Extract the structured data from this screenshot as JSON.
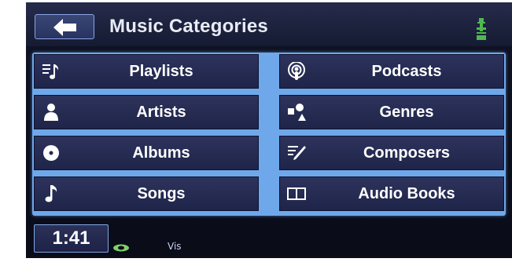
{
  "header": {
    "title": "Music Categories",
    "back_icon": "back-arrow-icon",
    "status_icon": "usb-icon"
  },
  "categories": [
    {
      "label": "Playlists",
      "icon": "playlist-icon"
    },
    {
      "label": "Podcasts",
      "icon": "podcast-icon"
    },
    {
      "label": "Artists",
      "icon": "artist-icon"
    },
    {
      "label": "Genres",
      "icon": "genres-icon"
    },
    {
      "label": "Albums",
      "icon": "album-icon"
    },
    {
      "label": "Composers",
      "icon": "composer-icon"
    },
    {
      "label": "Songs",
      "icon": "song-icon"
    },
    {
      "label": "Audio Books",
      "icon": "audiobook-icon"
    }
  ],
  "footer": {
    "clock": "1:41",
    "small_text": "Vis"
  },
  "colors": {
    "background": "#0b0e1c",
    "tile": "#252a52",
    "grid_border": "#6fa8ea",
    "text": "#ffffff"
  }
}
